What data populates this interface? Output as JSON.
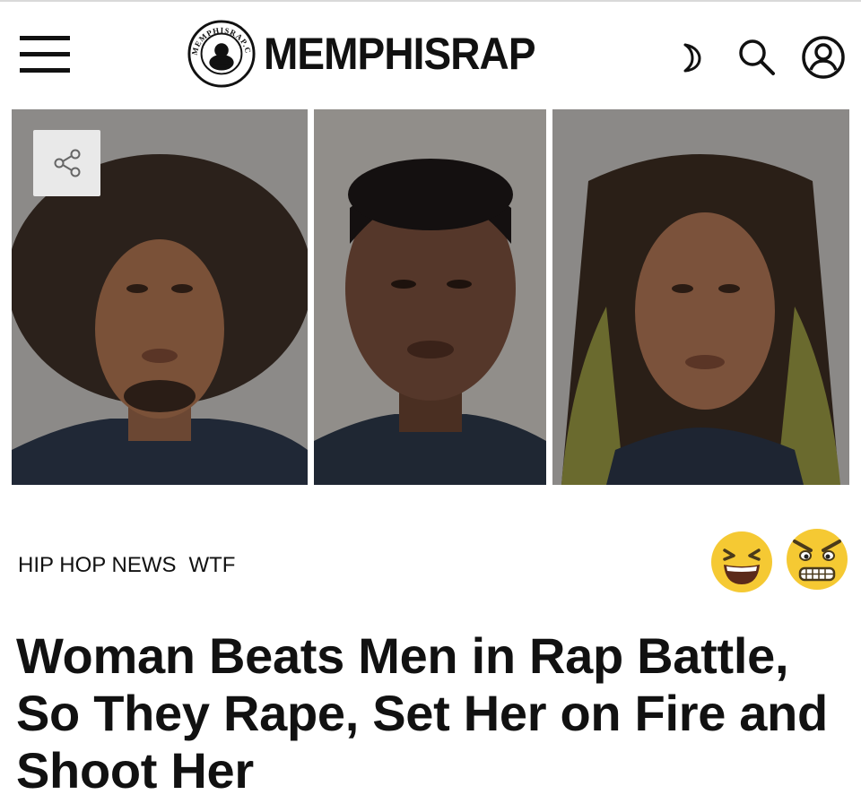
{
  "header": {
    "logo_text": "MEMPHISRAP",
    "logo_badge_text": "MEMPHISRAP.COM",
    "menu_icon": "hamburger-menu-icon",
    "moon_icon": "moon-icon",
    "search_icon": "search-icon",
    "user_icon": "user-account-icon"
  },
  "hero": {
    "photo_count": 3,
    "share_icon": "share-icon"
  },
  "article": {
    "categories": [
      "HIP HOP NEWS",
      "WTF"
    ],
    "reactions": [
      "laughing-emoji",
      "angry-emoji"
    ],
    "headline": "Woman Beats Men in Rap Battle, So They Rape, Set Her on Fire and Shoot Her"
  },
  "colors": {
    "emoji_yellow": "#f5c933",
    "share_bg": "#e9e9e9",
    "text": "#111111"
  }
}
